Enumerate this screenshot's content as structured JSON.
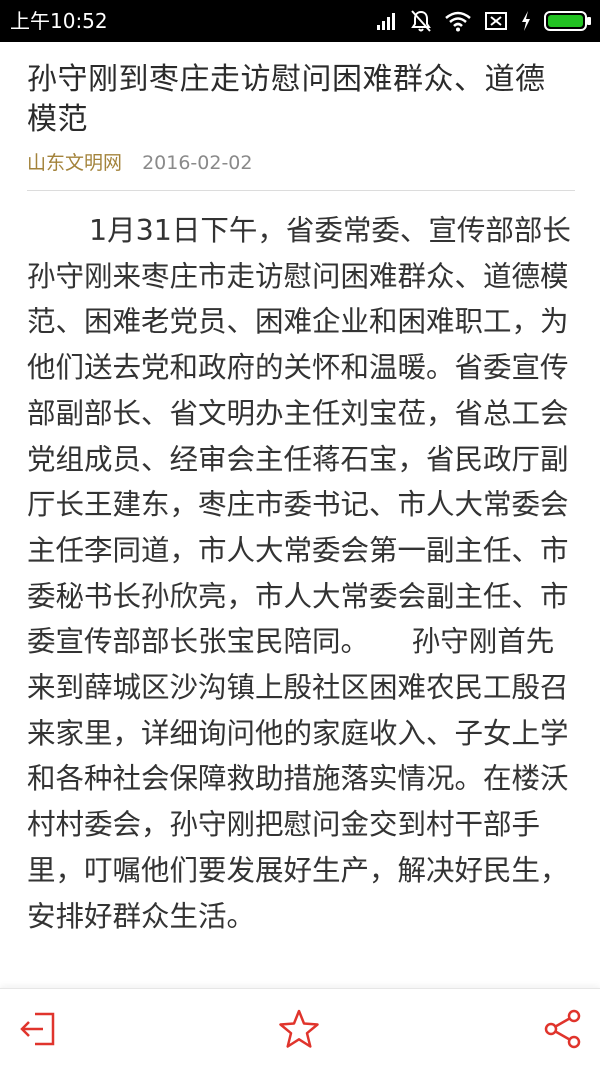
{
  "status_bar": {
    "time": "上午10:52",
    "icons": [
      "signal-icon",
      "mute-icon",
      "wifi-icon",
      "sim-disabled-icon",
      "charging-icon",
      "battery-icon"
    ],
    "battery_color": "#22c222"
  },
  "article": {
    "title": "孙守刚到枣庄走访慰问困难群众、道德模范",
    "source": "山东文明网",
    "date": "2016-02-02",
    "body": "1月31日下午，省委常委、宣传部部长孙守刚来枣庄市走访慰问困难群众、道德模范、困难老党员、困难企业和困难职工，为他们送去党和政府的关怀和温暖。省委宣传部副部长、省文明办主任刘宝莅，省总工会党组成员、经审会主任蒋石宝，省民政厅副厅长王建东，枣庄市委书记、市人大常委会主任李同道，市人大常委会第一副主任、市委秘书长孙欣亮，市人大常委会副主任、市委宣传部部长张宝民陪同。　　孙守刚首先来到薛城区沙沟镇上殷社区困难农民工殷召来家里，详细询问他的家庭收入、子女上学和各种社会保障救助措施落实情况。在楼沃村村委会，孙守刚把慰问金交到村干部手里，叮嘱他们要发展好生产，解决好民生，安排好群众生活。"
  },
  "bottom_bar": {
    "accent_color": "#e0342c",
    "actions": [
      "exit-icon",
      "star-icon",
      "share-icon"
    ]
  }
}
